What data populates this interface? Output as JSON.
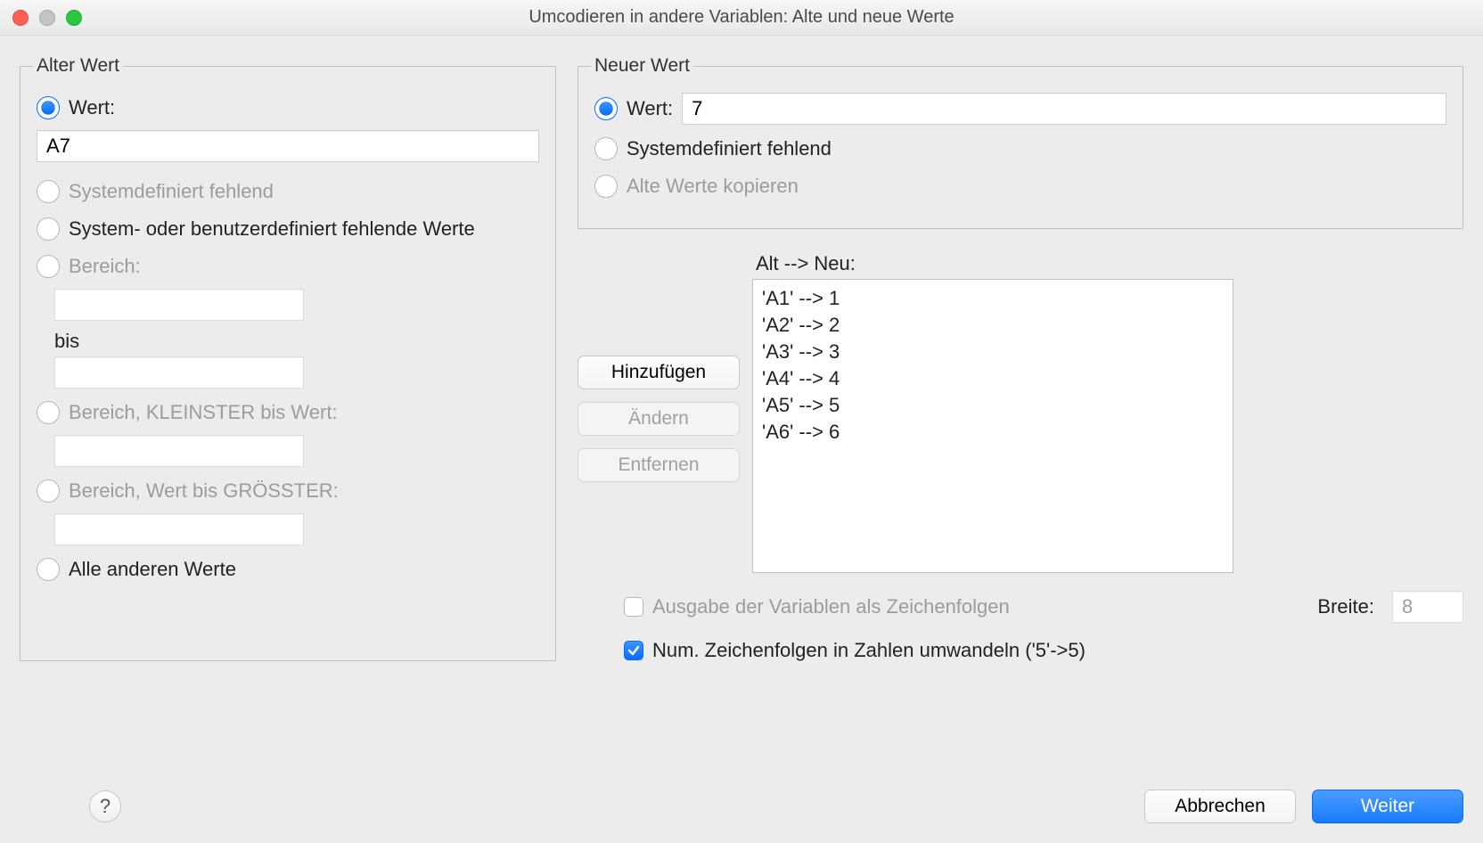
{
  "window": {
    "title": "Umcodieren in andere Variablen: Alte und neue Werte"
  },
  "old": {
    "legend": "Alter Wert",
    "radio_value_label": "Wert:",
    "value_input": "A7",
    "radio_sysmissing": "Systemdefiniert fehlend",
    "radio_sysuser_missing": "System- oder benutzerdefiniert fehlende Werte",
    "radio_range": "Bereich:",
    "bis_label": "bis",
    "radio_range_lowest": "Bereich, KLEINSTER bis Wert:",
    "radio_range_highest": "Bereich, Wert bis GRÖSSTER:",
    "radio_all_other": "Alle anderen Werte"
  },
  "new": {
    "legend": "Neuer Wert",
    "radio_value_label": "Wert:",
    "value_input": "7",
    "radio_sysmissing": "Systemdefiniert fehlend",
    "radio_copy": "Alte Werte kopieren"
  },
  "mapping": {
    "label": "Alt --> Neu:",
    "add": "Hinzufügen",
    "change": "Ändern",
    "remove": "Entfernen",
    "items": [
      "'A1' --> 1",
      "'A2' --> 2",
      "'A3' --> 3",
      "'A4' --> 4",
      "'A5' --> 5",
      "'A6' --> 6"
    ]
  },
  "options": {
    "output_as_string": "Ausgabe der Variablen als Zeichenfolgen",
    "breite_label": "Breite:",
    "breite_value": "8",
    "numeric_strings": "Num. Zeichenfolgen in Zahlen umwandeln ('5'->5)"
  },
  "buttons": {
    "help": "?",
    "cancel": "Abbrechen",
    "continue": "Weiter"
  }
}
